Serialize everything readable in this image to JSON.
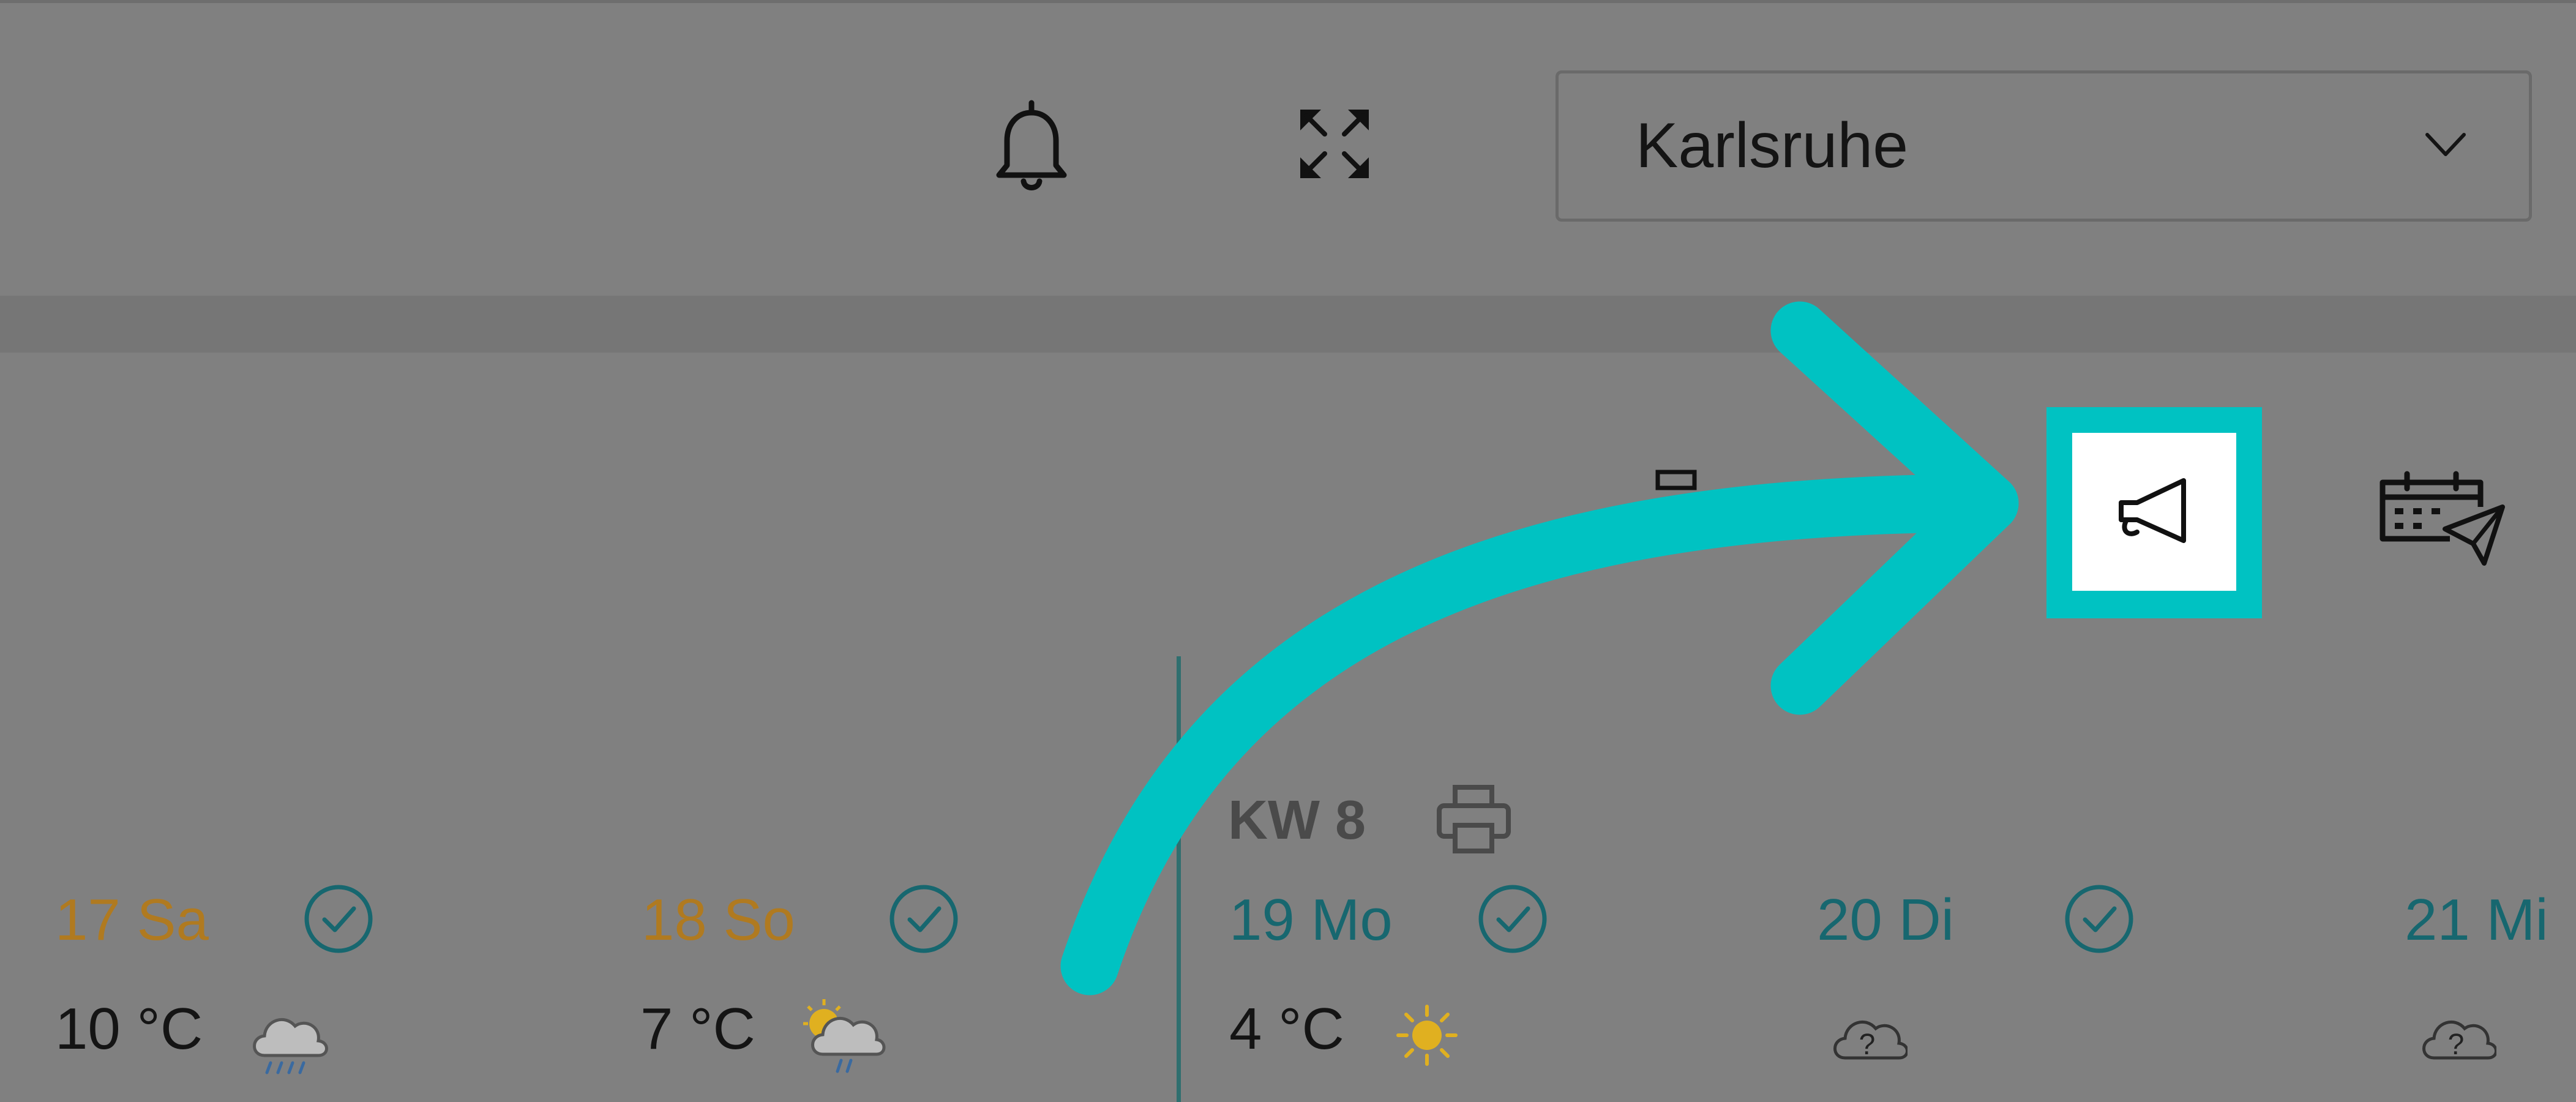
{
  "header": {
    "city_select": {
      "value": "Karlsruhe"
    }
  },
  "toolbar": {
    "icons": [
      "bell-icon",
      "fullscreen-icon",
      "megaphone-icon",
      "calendar-send-icon"
    ]
  },
  "week": {
    "label": "KW 8"
  },
  "days": [
    {
      "label": "17 Sa",
      "temp": "10 °C",
      "weather": "rain-cloud-icon",
      "checked": true
    },
    {
      "label": "18 So",
      "temp": "7 °C",
      "weather": "sun-cloud-rain-icon",
      "checked": true
    },
    {
      "label": "19 Mo",
      "temp": "4 °C",
      "weather": "sun-icon",
      "checked": true
    },
    {
      "label": "20 Di",
      "temp": "",
      "weather": "unknown-weather-icon",
      "checked": true
    },
    {
      "label": "21 Mi",
      "temp": "",
      "weather": "unknown-weather-icon",
      "checked": false
    }
  ],
  "colors": {
    "highlight": "#00c2c2",
    "weekend_day": "#b07a20",
    "weekday": "#17676f",
    "overlay": "#808080"
  }
}
